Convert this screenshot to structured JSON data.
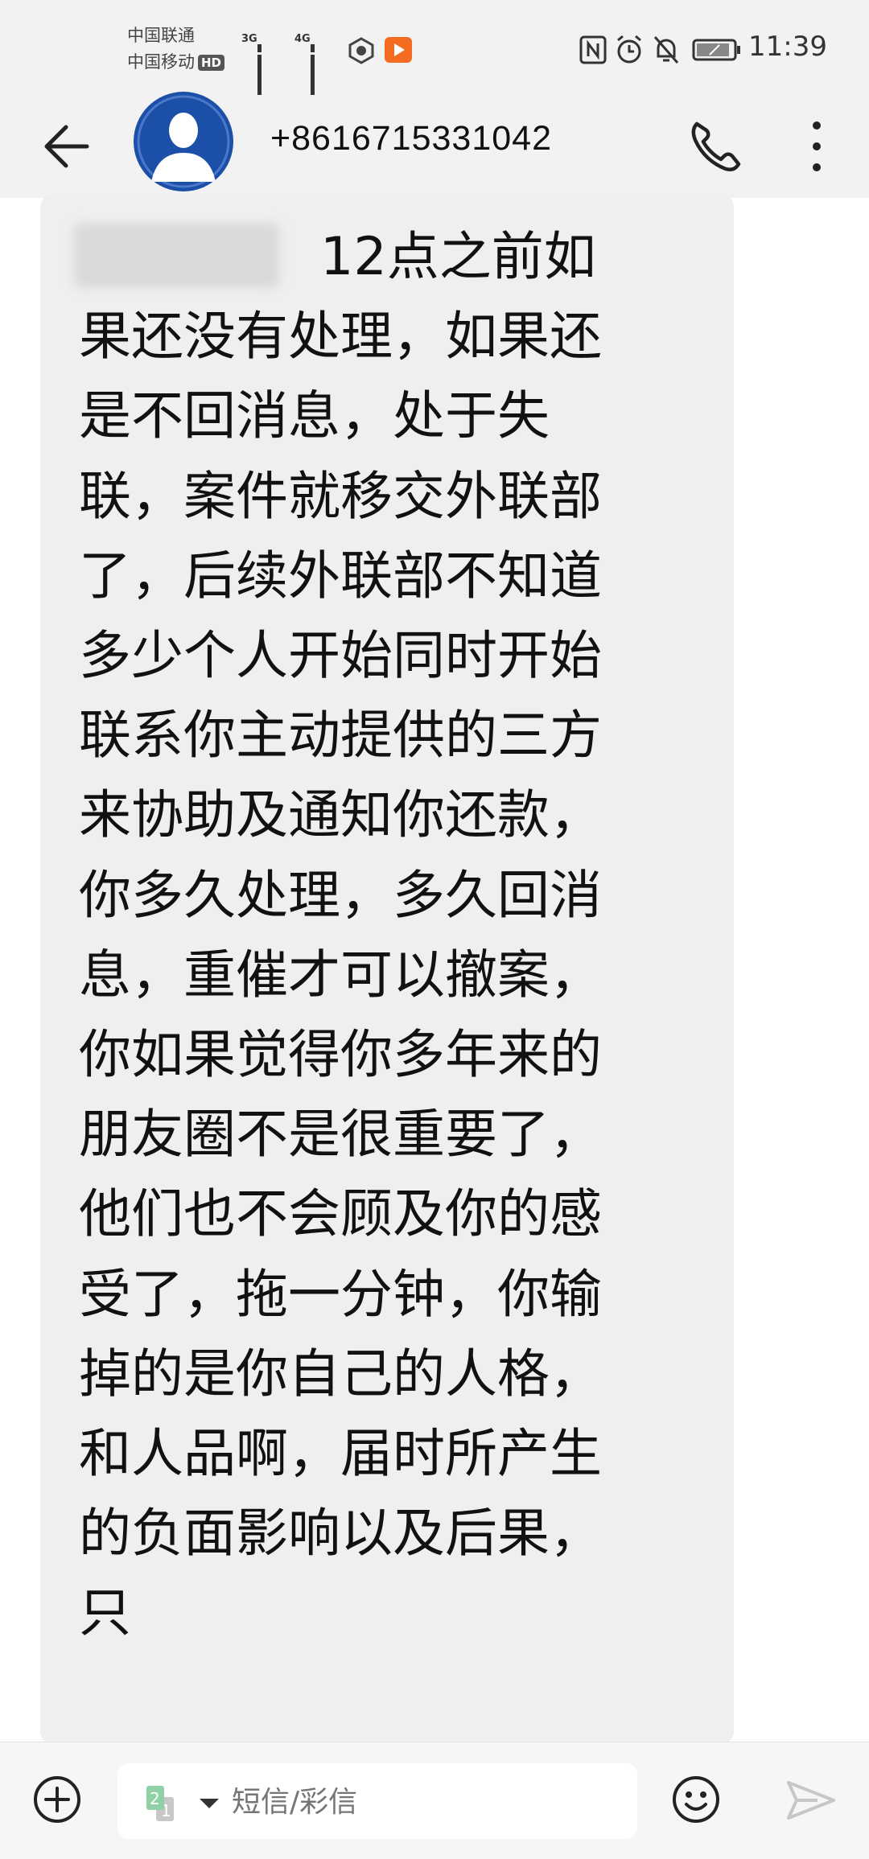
{
  "status_bar": {
    "carrier_1": "中国联通",
    "carrier_2": "中国移动",
    "hd_badge": "HD",
    "signal_1_label": "3G",
    "signal_2_label": "4G",
    "time": "11:39"
  },
  "header": {
    "contact_number": "+8616715331042"
  },
  "message": {
    "text": "12点之前如果还没有处理，如果还是不回消息，处于失联，案件就移交外联部了，后续外联部不知道多少个人开始同时开始联系你主动提供的三方来协助及通知你还款，你多久处理，多久回消息，重催才可以撤案，你如果觉得你多年来的朋友圈不是很重要了，他们也不会顾及你的感受了，拖一分钟，你输掉的是你自己的人格，和人品啊，届时所产生的负面影响以及后果，只"
  },
  "composer": {
    "sim_number": "2",
    "placeholder": "短信/彩信"
  },
  "icons": {
    "back": "arrow-left-icon",
    "avatar": "person-avatar-icon",
    "call": "phone-icon",
    "more": "more-vertical-icon",
    "add": "plus-circle-icon",
    "sim": "sim-card-icon",
    "emoji": "smiley-icon",
    "send": "send-icon",
    "nfc": "nfc-icon",
    "alarm": "alarm-icon",
    "mute": "bell-off-icon",
    "battery": "battery-icon"
  },
  "colors": {
    "avatar_bg": "#1c4fa8",
    "bubble_bg": "#efefef",
    "app_bar_bg": "#f2f2f2",
    "play_badge": "#f36c21"
  }
}
